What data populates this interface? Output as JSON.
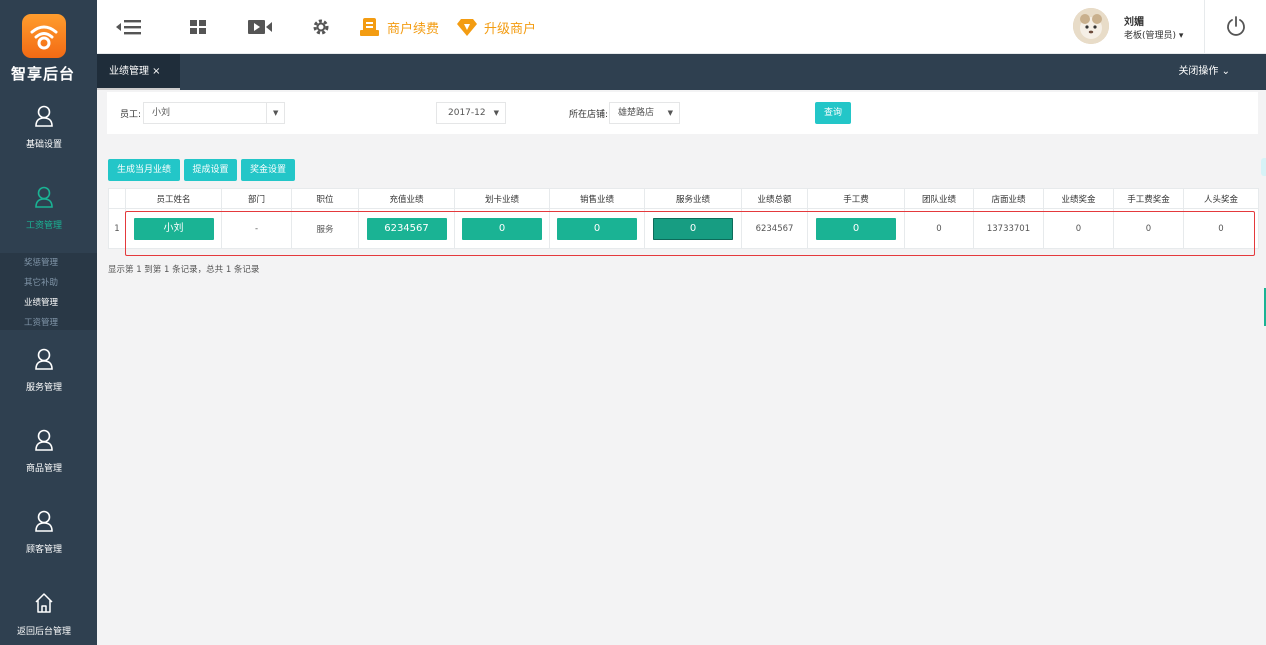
{
  "brand": {
    "name": "智享后台"
  },
  "sidebar": {
    "items": [
      {
        "label": "基础设置",
        "icon": "user-icon"
      },
      {
        "label": "工资管理",
        "icon": "user-icon",
        "active": true
      },
      {
        "label": "服务管理",
        "icon": "user-icon"
      },
      {
        "label": "商品管理",
        "icon": "user-icon"
      },
      {
        "label": "顾客管理",
        "icon": "user-icon"
      },
      {
        "label": "返回后台管理",
        "icon": "home-icon"
      }
    ],
    "submenu": [
      "奖惩管理",
      "其它补助",
      "业绩管理",
      "工资管理"
    ],
    "submenu_current": "业绩管理"
  },
  "topbar": {
    "renew_label": "商户续费",
    "upgrade_label": "升级商户",
    "user_name": "刘媚",
    "user_role": "老板(管理员) ▾"
  },
  "tabs": {
    "active_label": "业绩管理 ×",
    "close_ops_label": "关闭操作 ⌄"
  },
  "filter": {
    "employee_label": "员工:",
    "employee_value": "小刘",
    "month_value": "2017-12",
    "store_label": "所在店铺:",
    "store_value": "雄楚路店",
    "query_label": "查询"
  },
  "actions": {
    "generate_label": "生成当月业绩",
    "commission_label": "提成设置",
    "bonus_label": "奖金设置"
  },
  "table": {
    "headers": [
      "员工姓名",
      "部门",
      "职位",
      "充值业绩",
      "划卡业绩",
      "销售业绩",
      "服务业绩",
      "业绩总额",
      "手工费",
      "团队业绩",
      "店面业绩",
      "业绩奖金",
      "手工费奖金",
      "人头奖金"
    ],
    "rows": [
      {
        "index": "1",
        "name": "小刘",
        "department": "-",
        "position": "服务",
        "recharge": "6234567",
        "card": "0",
        "sales": "0",
        "service": "0",
        "total": "6234567",
        "handwork": "0",
        "team": "0",
        "store": "13733701",
        "perf_bonus": "0",
        "handwork_bonus": "0",
        "head_bonus": "0"
      }
    ],
    "footer": "显示第 1 到第 1 条记录，总共 1 条记录"
  },
  "colors": {
    "sidebar": "#2f4050",
    "accent_green": "#1ab394",
    "accent_cyan": "#23c6c8",
    "accent_orange": "#f39c12",
    "highlight_red": "#e4393c"
  }
}
